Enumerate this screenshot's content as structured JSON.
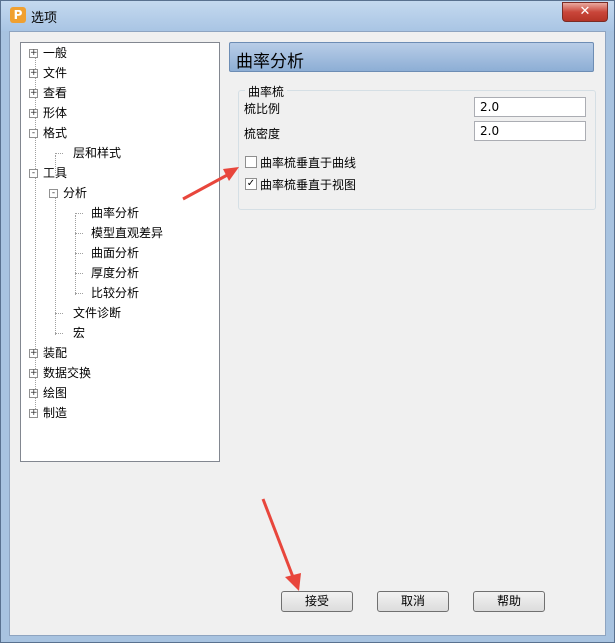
{
  "window": {
    "title": "选项",
    "app_icon": "P",
    "close_label": "✕"
  },
  "tree": {
    "items": [
      {
        "label": "一般",
        "expander": "+"
      },
      {
        "label": "文件",
        "expander": "+"
      },
      {
        "label": "查看",
        "expander": "+"
      },
      {
        "label": "形体",
        "expander": "+"
      },
      {
        "label": "格式",
        "expander": "-"
      },
      {
        "label": "层和样式"
      },
      {
        "label": "工具",
        "expander": "-"
      },
      {
        "label": "分析",
        "expander": "-"
      },
      {
        "label": "曲率分析"
      },
      {
        "label": "模型直观差异"
      },
      {
        "label": "曲面分析"
      },
      {
        "label": "厚度分析"
      },
      {
        "label": "比较分析"
      },
      {
        "label": "文件诊断"
      },
      {
        "label": "宏"
      },
      {
        "label": "装配",
        "expander": "+"
      },
      {
        "label": "数据交换",
        "expander": "+"
      },
      {
        "label": "绘图",
        "expander": "+"
      },
      {
        "label": "制造",
        "expander": "+"
      }
    ]
  },
  "panel": {
    "title": "曲率分析",
    "group_label": "曲率梳",
    "scale_label": "梳比例",
    "scale_value": "2.0",
    "density_label": "梳密度",
    "density_value": "2.0",
    "check1_label": "曲率梳垂直于曲线",
    "check1_mark": "",
    "check2_label": "曲率梳垂直于视图",
    "check2_mark": "✓"
  },
  "buttons": {
    "accept": "接受",
    "cancel": "取消",
    "help": "帮助"
  },
  "colors": {
    "arrow": "#e8463c",
    "header": "#9db9dc"
  }
}
